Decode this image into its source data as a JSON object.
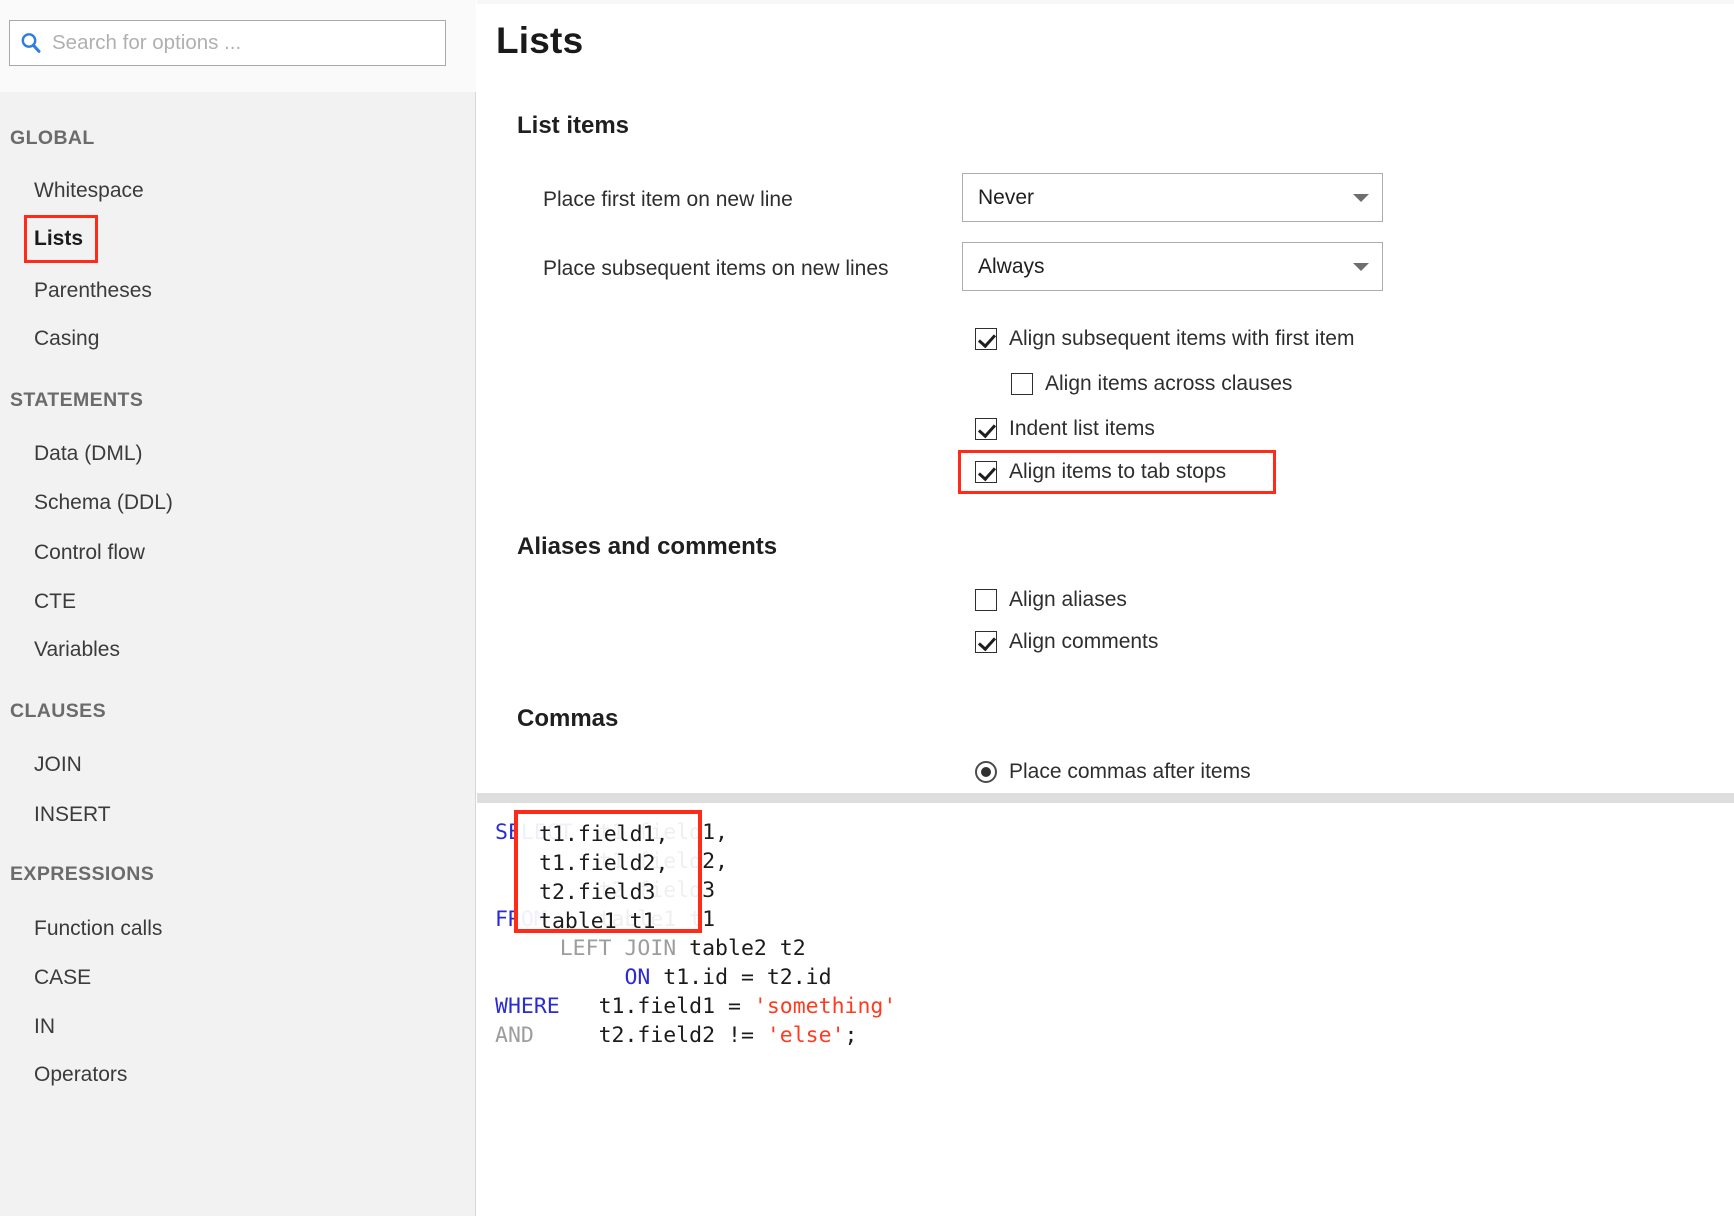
{
  "search": {
    "placeholder": "Search for options ...",
    "value": "",
    "icon": "search-icon"
  },
  "sidebar": {
    "groups": [
      {
        "title": "GLOBAL",
        "items": [
          {
            "label": "Whitespace",
            "selected": false
          },
          {
            "label": "Lists",
            "selected": true,
            "highlighted": true
          },
          {
            "label": "Parentheses",
            "selected": false
          },
          {
            "label": "Casing",
            "selected": false
          }
        ]
      },
      {
        "title": "STATEMENTS",
        "items": [
          {
            "label": "Data (DML)",
            "selected": false
          },
          {
            "label": "Schema (DDL)",
            "selected": false
          },
          {
            "label": "Control flow",
            "selected": false
          },
          {
            "label": "CTE",
            "selected": false
          },
          {
            "label": "Variables",
            "selected": false
          }
        ]
      },
      {
        "title": "CLAUSES",
        "items": [
          {
            "label": "JOIN",
            "selected": false
          },
          {
            "label": "INSERT",
            "selected": false
          }
        ]
      },
      {
        "title": "EXPRESSIONS",
        "items": [
          {
            "label": "Function calls",
            "selected": false
          },
          {
            "label": "CASE",
            "selected": false
          },
          {
            "label": "IN",
            "selected": false
          },
          {
            "label": "Operators",
            "selected": false
          }
        ]
      }
    ]
  },
  "main": {
    "page_title": "Lists",
    "sections": {
      "list_items": {
        "heading": "List items",
        "dropdowns": [
          {
            "label": "Place first item on new line",
            "value": "Never"
          },
          {
            "label": "Place subsequent items on new lines",
            "value": "Always"
          }
        ],
        "checkboxes": [
          {
            "label": "Align subsequent items with first item",
            "checked": true,
            "indent": 0
          },
          {
            "label": "Align items across clauses",
            "checked": false,
            "indent": 1
          },
          {
            "label": "Indent list items",
            "checked": true,
            "indent": 0
          },
          {
            "label": "Align items to tab stops",
            "checked": true,
            "indent": 0,
            "highlighted": true
          }
        ]
      },
      "aliases_and_comments": {
        "heading": "Aliases and comments",
        "checkboxes": [
          {
            "label": "Align aliases",
            "checked": false
          },
          {
            "label": "Align comments",
            "checked": true
          }
        ]
      },
      "commas": {
        "heading": "Commas",
        "radios": [
          {
            "label": "Place commas after items",
            "selected": true
          }
        ]
      }
    }
  },
  "preview": {
    "lines": [
      {
        "segments": [
          {
            "t": "SELECT",
            "c": "kw"
          },
          {
            "t": "  t1.field1,",
            "c": ""
          }
        ]
      },
      {
        "segments": [
          {
            "t": "        t1.field2,",
            "c": ""
          }
        ]
      },
      {
        "segments": [
          {
            "t": "        t2.field3",
            "c": ""
          }
        ]
      },
      {
        "segments": [
          {
            "t": "FROM",
            "c": "kw"
          },
          {
            "t": "    table1 t1",
            "c": ""
          }
        ]
      },
      {
        "segments": [
          {
            "t": "     LEFT JOIN",
            "c": "kwg"
          },
          {
            "t": " table2 t2",
            "c": ""
          }
        ]
      },
      {
        "segments": [
          {
            "t": "          ON",
            "c": "kw"
          },
          {
            "t": " t1.id = t2.id",
            "c": ""
          }
        ]
      },
      {
        "segments": [
          {
            "t": "WHERE",
            "c": "kw"
          },
          {
            "t": "   t1.field1 = ",
            "c": ""
          },
          {
            "t": "'something'",
            "c": "str"
          }
        ]
      },
      {
        "segments": [
          {
            "t": "AND",
            "c": "kwg"
          },
          {
            "t": "     t2.field2 != ",
            "c": ""
          },
          {
            "t": "'else'",
            "c": "str"
          },
          {
            "t": ";",
            "c": ""
          }
        ]
      }
    ],
    "highlight_overlay_lines": [
      "t1.field1,",
      "t1.field2,",
      "t2.field3",
      "table1 t1"
    ]
  },
  "colors": {
    "highlight_red": "#ff2a18",
    "sidebar_bg": "#f2f2f2",
    "keyword_blue": "#2b2bd4",
    "keyword_grey": "#9d9d9d",
    "string_red": "#ff3b20",
    "search_icon_blue": "#2f7de1"
  }
}
